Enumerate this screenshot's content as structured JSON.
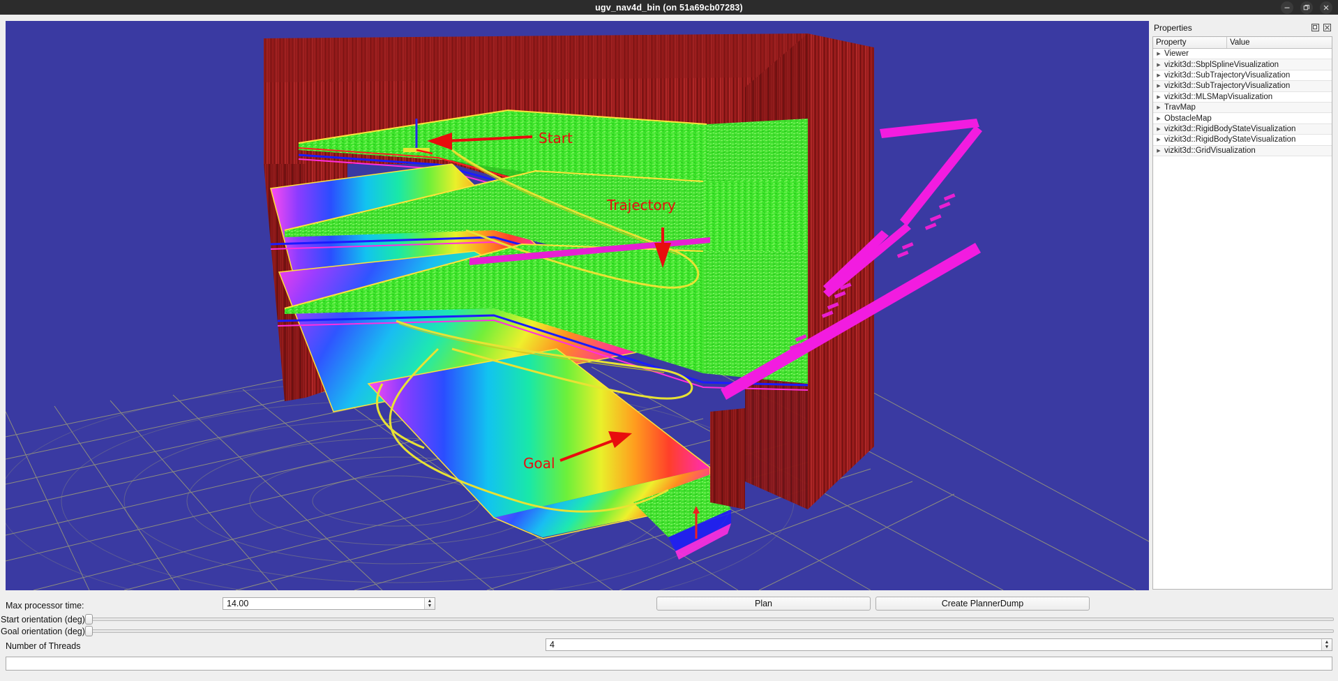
{
  "window": {
    "title": "ugv_nav4d_bin (on 51a69cb07283)",
    "minimize_label": "—",
    "restore_label": "❐",
    "close_label": "✕"
  },
  "properties_dock": {
    "title": "Properties",
    "float_icon": "float-icon",
    "close_icon": "close-icon",
    "columns": [
      "Property",
      "Value"
    ],
    "rows": [
      {
        "name": "Viewer",
        "value": ""
      },
      {
        "name": "vizkit3d::SbplSplineVisualization",
        "value": ""
      },
      {
        "name": "vizkit3d::SubTrajectoryVisualization",
        "value": ""
      },
      {
        "name": "vizkit3d::SubTrajectoryVisualization",
        "value": ""
      },
      {
        "name": "vizkit3d::MLSMapVisualization",
        "value": ""
      },
      {
        "name": "TravMap",
        "value": ""
      },
      {
        "name": "ObstacleMap",
        "value": ""
      },
      {
        "name": "vizkit3d::RigidBodyStateVisualization",
        "value": ""
      },
      {
        "name": "vizkit3d::RigidBodyStateVisualization",
        "value": ""
      },
      {
        "name": "vizkit3d::GridVisualization",
        "value": ""
      }
    ],
    "expander_glyph": "▶"
  },
  "viewport": {
    "background_color": "#3a3aa2",
    "annotations": [
      {
        "text": "Start",
        "color": "#e80d0d"
      },
      {
        "text": "Trajectory",
        "color": "#e80d0d"
      },
      {
        "text": "Goal",
        "color": "#e80d0d"
      }
    ],
    "scene_colors": {
      "wall": "#9e1c1c",
      "floor": "#3de02a",
      "trajectory_magenta": "#ff23e0",
      "spline_yellow": "#e8e234",
      "grid_line": "#9b9b7a"
    }
  },
  "controls": {
    "max_processor_time_label": "Max processor time:",
    "max_processor_time_value": "14.00",
    "start_orientation_label": "Start orientation (deg)",
    "goal_orientation_label": "Goal orientation (deg)",
    "number_of_threads_label": "Number of Threads",
    "number_of_threads_value": "4",
    "plan_button": "Plan",
    "create_planner_dump_button": "Create PlannerDump",
    "status_field_value": "",
    "spin_up_glyph": "▲",
    "spin_down_glyph": "▼"
  }
}
